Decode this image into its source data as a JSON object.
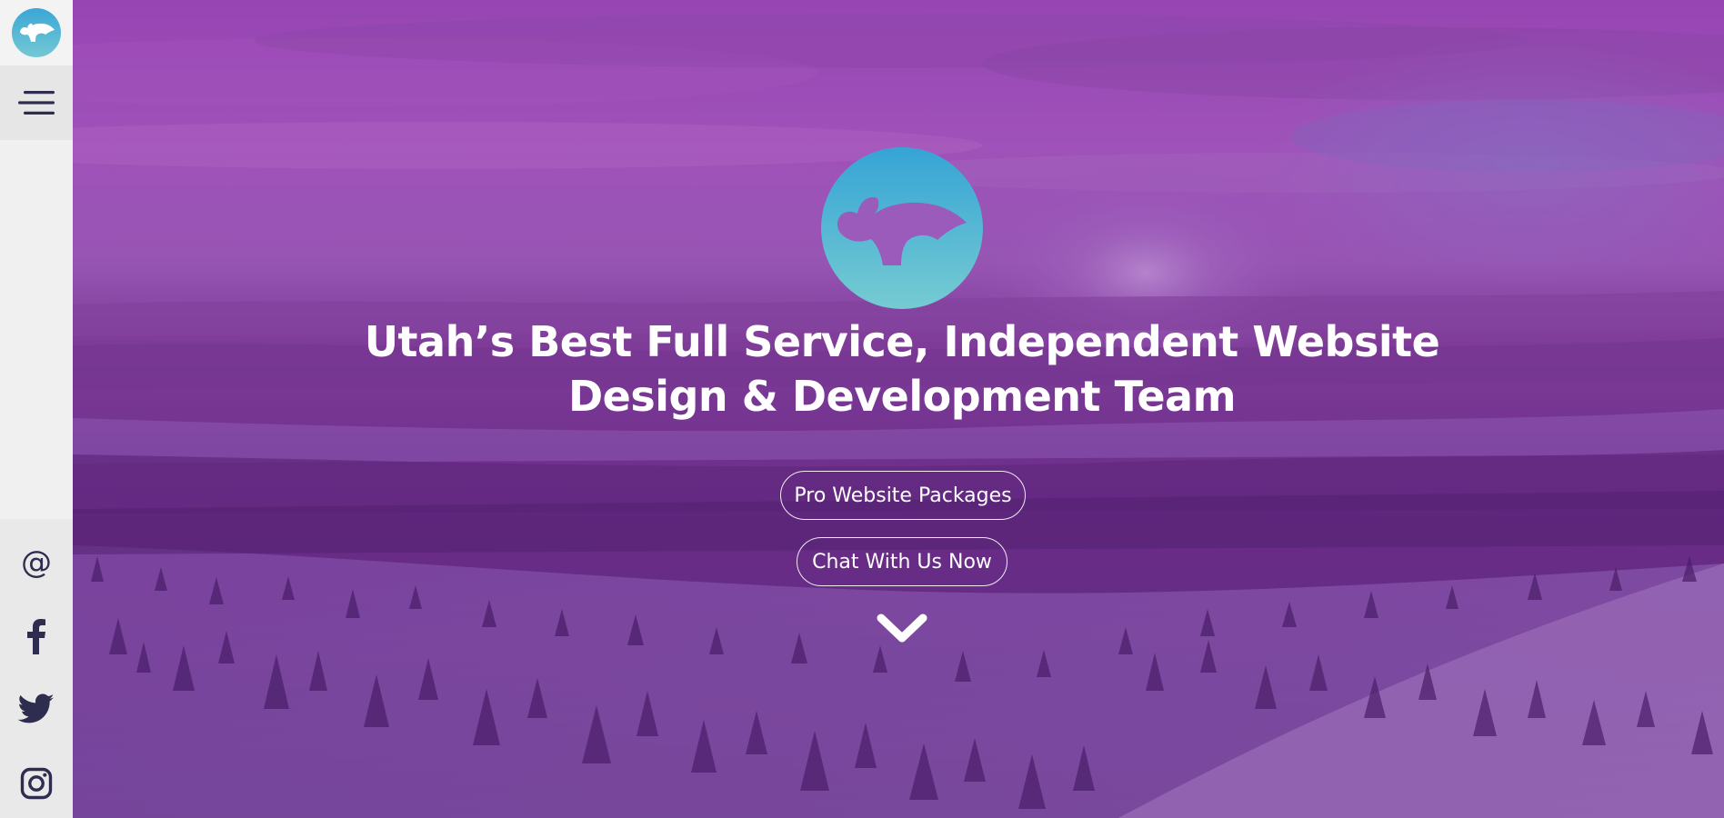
{
  "brand": {
    "logo_icon": "otter-logo-icon",
    "colors": {
      "logo_gradient_top": "#3aa7d6",
      "logo_gradient_bottom": "#74c8d3",
      "sidebar_bg": "#f0f0f0",
      "sidebar_icon": "#2e2c4f",
      "overlay_purple": "#7b2fa0"
    }
  },
  "sidebar": {
    "menu_icon": "hamburger-menu-icon",
    "social": [
      {
        "name": "email-icon",
        "glyph": "@"
      },
      {
        "name": "facebook-icon"
      },
      {
        "name": "twitter-icon"
      },
      {
        "name": "instagram-icon"
      }
    ]
  },
  "hero": {
    "headline_line1": "Utah’s Best Full Service, Independent Website",
    "headline_line2": "Design & Development Team",
    "buttons": {
      "packages_label": "Pro Website Packages",
      "chat_label": "Chat With Us Now"
    },
    "scroll_icon": "chevron-down-icon"
  }
}
